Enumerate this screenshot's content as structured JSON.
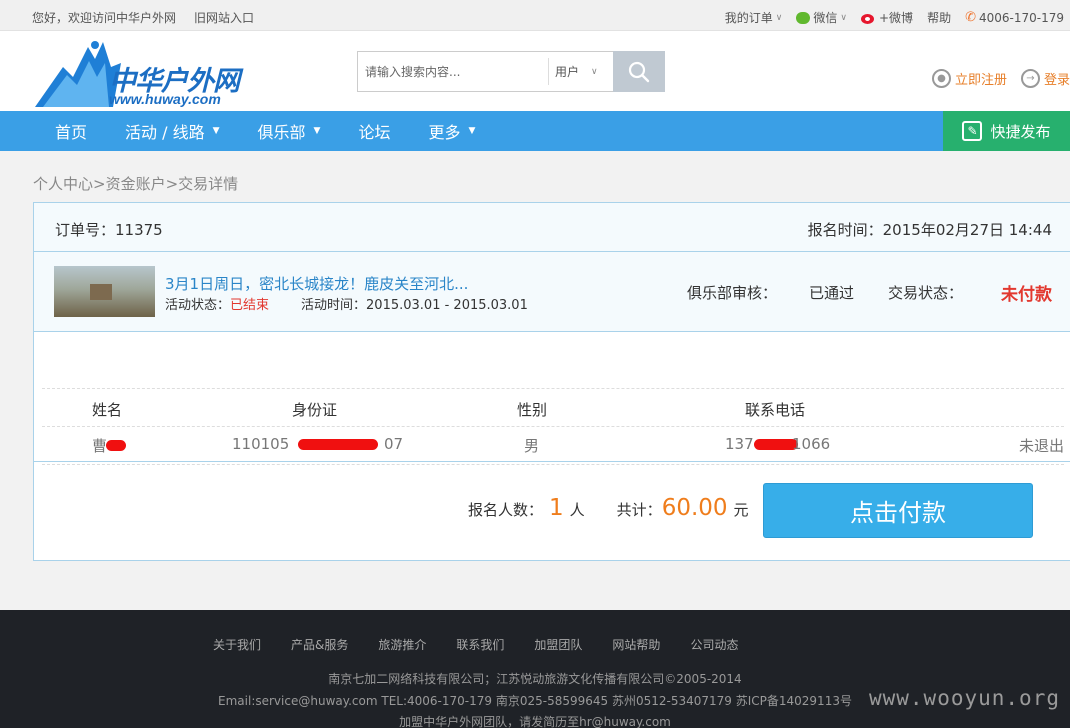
{
  "topbar": {
    "welcome": "您好，欢迎访问中华户外网",
    "old_site": "旧网站入口",
    "my_orders": "我的订单",
    "wechat": "微信",
    "weibo": "+微博",
    "help": "帮助",
    "phone": "4006-170-179"
  },
  "header": {
    "logo_cn": "中华户外网",
    "logo_en": "www.huway.com",
    "search_placeholder": "请输入搜索内容...",
    "search_scope": "用户",
    "register": "立即注册",
    "login": "登录"
  },
  "nav": {
    "items": [
      "首页",
      "活动 / 线路",
      "俱乐部",
      "论坛",
      "更多"
    ],
    "quick_publish": "快捷发布"
  },
  "breadcrumb": "个人中心>资金账户>交易详情",
  "order": {
    "order_no": "订单号：11375",
    "signup_time": "报名时间：2015年02月27日 14:44",
    "activity_title": "3月1日周日，密北长城接龙！鹿皮关至河北...",
    "activity_status_label": "活动状态：",
    "activity_status": "已结束",
    "activity_time": "活动时间：2015.03.01 - 2015.03.01",
    "club_review_label": "俱乐部审核：",
    "club_review": "已通过",
    "trade_status_label": "交易状态：",
    "trade_status": "未付款"
  },
  "participants": {
    "headers": [
      "姓名",
      "身份证",
      "性别",
      "联系电话"
    ],
    "rows": [
      {
        "name": "曹",
        "id": "110105",
        "id_tail": "07",
        "gender": "男",
        "phone": "137",
        "phone_tail": "1066",
        "state": "未退出"
      }
    ]
  },
  "summary": {
    "count_label": "报名人数：",
    "count": "1",
    "count_unit": "人",
    "total_label": "共计：",
    "total": "60.00",
    "total_unit": "元",
    "pay_button": "点击付款"
  },
  "footer": {
    "links": [
      "关于我们",
      "产品&服务",
      "旅游推介",
      "联系我们",
      "加盟团队",
      "网站帮助",
      "公司动态"
    ],
    "company": "南京七加二网络科技有限公司；江苏悦动旅游文化传播有限公司©2005-2014",
    "contact": "Email:service@huway.com TEL:4006-170-179 南京025-58599645 苏州0512-53407179 苏ICP备14029113号",
    "join": "加盟中华户外网团队，请发简历至hr@huway.com",
    "watermark": "www.wooyun.org"
  },
  "colors": {
    "nav_blue": "#3a9fe6",
    "quick_green": "#27b06e",
    "accent_orange": "#ef7d1c",
    "status_red": "#e2382f",
    "link_blue": "#2a85c8"
  }
}
